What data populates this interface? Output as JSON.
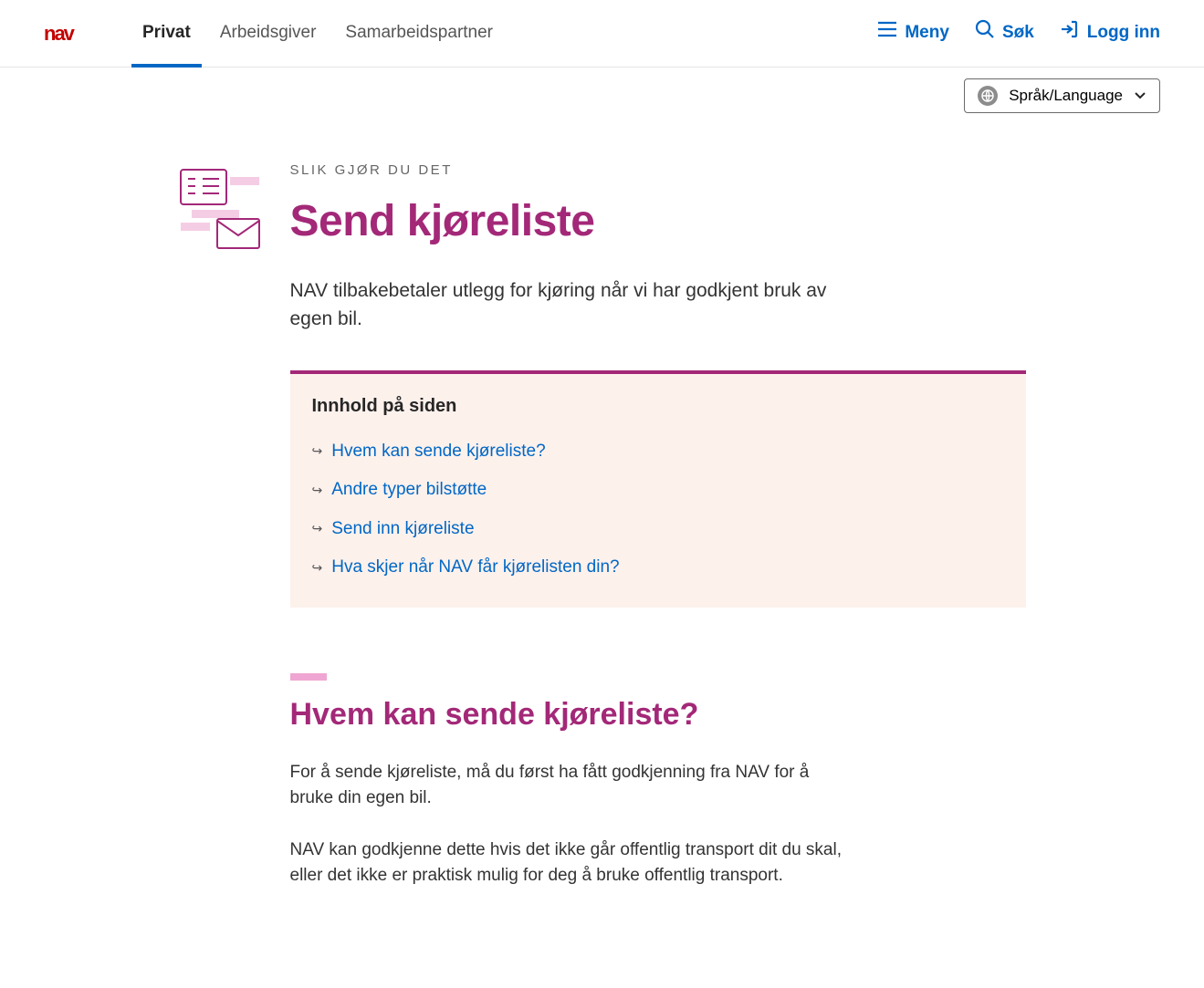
{
  "header": {
    "logo_text": "nav",
    "tabs": [
      {
        "label": "Privat",
        "active": true
      },
      {
        "label": "Arbeidsgiver",
        "active": false
      },
      {
        "label": "Samarbeidspartner",
        "active": false
      }
    ],
    "actions": {
      "menu": "Meny",
      "search": "Søk",
      "login": "Logg inn"
    },
    "language_label": "Språk/Language"
  },
  "page": {
    "eyebrow": "SLIK GJØR DU DET",
    "title": "Send kjøreliste",
    "lead": "NAV tilbakebetaler utlegg for kjøring når vi har godkjent bruk av egen bil."
  },
  "toc": {
    "heading": "Innhold på siden",
    "items": [
      "Hvem kan sende kjøreliste?",
      "Andre typer bilstøtte",
      "Send inn kjøreliste",
      "Hva skjer når NAV får kjørelisten din?"
    ]
  },
  "section1": {
    "heading": "Hvem kan sende kjøreliste?",
    "p1": "For å sende kjøreliste, må du først ha fått godkjenning fra NAV for å bruke din egen bil.",
    "p2": "NAV kan godkjenne dette hvis det ikke går offentlig transport dit du skal, eller det ikke er praktisk mulig for deg å bruke offentlig transport."
  }
}
